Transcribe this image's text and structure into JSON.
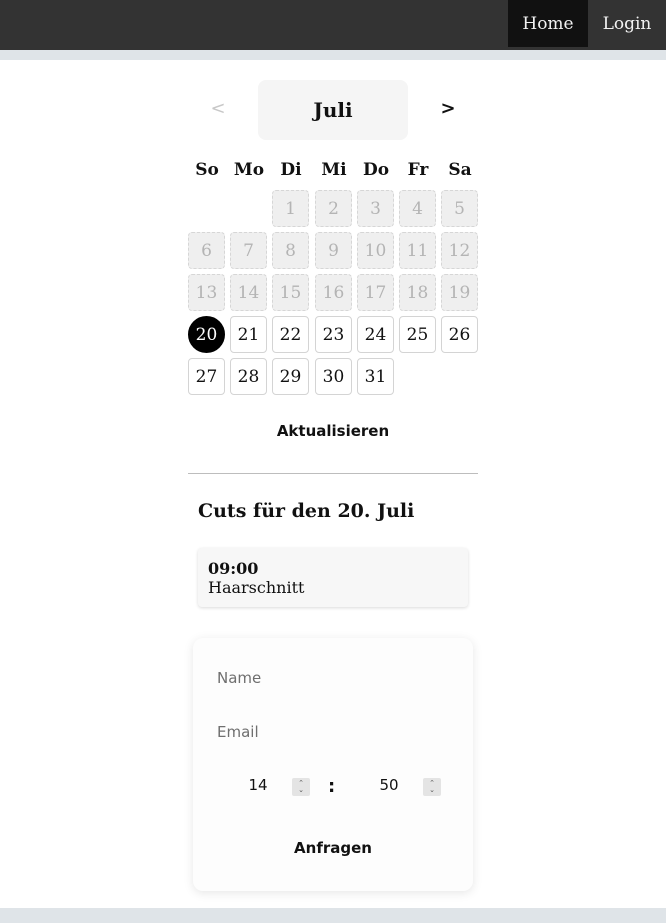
{
  "nav": {
    "home_label": "Home",
    "login_label": "Login"
  },
  "calendar": {
    "month": "Juli",
    "prev_symbol": "<",
    "next_symbol": ">",
    "weekdays": [
      "So",
      "Mo",
      "Di",
      "Mi",
      "Do",
      "Fr",
      "Sa"
    ],
    "first_weekday_index": 2,
    "days_in_month": 31,
    "selected_day": 20,
    "first_available_day": 21,
    "update_label": "Aktualisieren"
  },
  "cuts": {
    "title": "Cuts für den 20. Juli",
    "items": [
      {
        "time": "09:00",
        "service": "Haarschnitt"
      }
    ]
  },
  "form": {
    "name_placeholder": "Name",
    "email_placeholder": "Email",
    "hour": "14",
    "minute": "50",
    "separator": ":",
    "submit_label": "Anfragen"
  },
  "colors": {
    "topbar": "#333333",
    "nav_active": "#111111",
    "selected_day": "#000000",
    "background": "#dfe4e8"
  }
}
